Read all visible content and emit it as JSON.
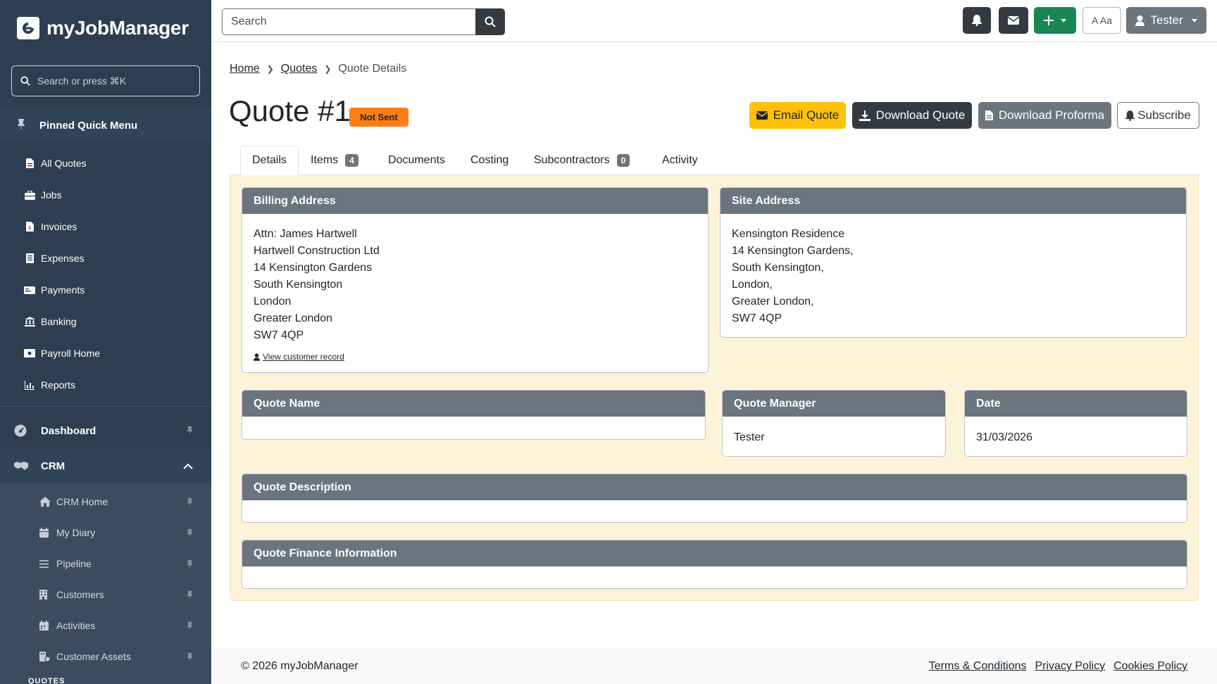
{
  "brand": {
    "name": "myJobManager"
  },
  "sidebar": {
    "search_placeholder": "Search or press ⌘K",
    "pinned_heading": "Pinned Quick Menu",
    "pinned_items": [
      {
        "label": "All Quotes",
        "icon": "file-icon"
      },
      {
        "label": "Jobs",
        "icon": "toolbox-icon"
      },
      {
        "label": "Invoices",
        "icon": "invoice-icon"
      },
      {
        "label": "Expenses",
        "icon": "receipt-icon"
      },
      {
        "label": "Payments",
        "icon": "money-icon"
      },
      {
        "label": "Banking",
        "icon": "bank-icon"
      },
      {
        "label": "Payroll Home",
        "icon": "cash-icon"
      },
      {
        "label": "Reports",
        "icon": "chart-icon"
      }
    ],
    "groups": [
      {
        "label": "Dashboard",
        "icon": "gauge-icon"
      },
      {
        "label": "CRM",
        "icon": "handshake-icon"
      }
    ],
    "crm_items": [
      {
        "label": "CRM Home",
        "icon": "home-icon"
      },
      {
        "label": "My Diary",
        "icon": "calendar-icon"
      },
      {
        "label": "Pipeline",
        "icon": "bars-icon"
      },
      {
        "label": "Customers",
        "icon": "building-icon"
      },
      {
        "label": "Activities",
        "icon": "calendar-icon"
      },
      {
        "label": "Customer Assets",
        "icon": "assets-icon"
      }
    ],
    "section_label": "QUOTES"
  },
  "topbar": {
    "search_placeholder": "Search",
    "font_toggle_label": "A Aa",
    "user_label": "Tester"
  },
  "breadcrumb": {
    "home": "Home",
    "quotes": "Quotes",
    "current": "Quote Details"
  },
  "quote": {
    "title": "Quote #1",
    "status": "Not Sent"
  },
  "actions": {
    "email": "Email Quote",
    "download": "Download Quote",
    "proforma": "Download Proforma",
    "subscribe": "Subscribe"
  },
  "tabs": [
    {
      "label": "Details"
    },
    {
      "label": "Items",
      "count": "4"
    },
    {
      "label": "Documents"
    },
    {
      "label": "Costing"
    },
    {
      "label": "Subcontractors",
      "count": "0"
    },
    {
      "label": "Activity"
    }
  ],
  "billing": {
    "heading": "Billing Address",
    "lines": [
      "Attn: James Hartwell",
      "Hartwell Construction Ltd",
      "14 Kensington Gardens",
      "South Kensington",
      "London",
      "Greater London",
      "SW7 4QP"
    ],
    "link": "View customer record"
  },
  "site": {
    "heading": "Site Address",
    "lines": [
      "Kensington Residence",
      "14 Kensington Gardens,",
      "South Kensington,",
      "London,",
      "Greater London,",
      "SW7 4QP"
    ]
  },
  "quote_name": {
    "heading": "Quote Name",
    "value": ""
  },
  "quote_manager": {
    "heading": "Quote Manager",
    "value": "Tester"
  },
  "date": {
    "heading": "Date",
    "value": "31/03/2026"
  },
  "quote_description": {
    "heading": "Quote Description",
    "value": ""
  },
  "quote_finance": {
    "heading": "Quote Finance Information",
    "value": ""
  },
  "footer": {
    "copyright": "© 2026 myJobManager",
    "terms": "Terms & Conditions",
    "privacy": "Privacy Policy",
    "cookies": "Cookies Policy"
  },
  "colors": {
    "sidebar_bg": "#2c3e50",
    "status_badge": "#fd7e14",
    "email_button": "#ffc107",
    "dark_button": "#343a40",
    "add_button": "#198754",
    "panel_bg": "#fcf3d9",
    "card_header": "#6c7480"
  }
}
